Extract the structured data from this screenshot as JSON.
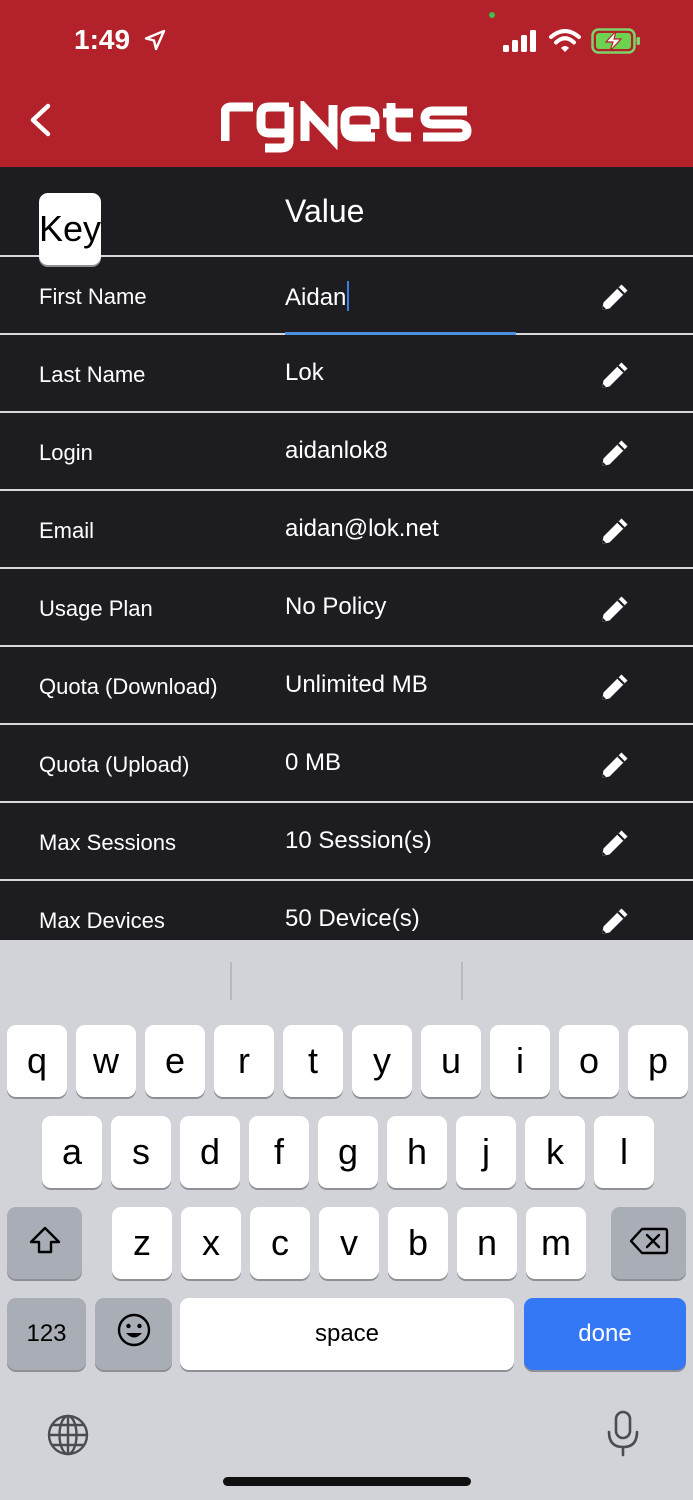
{
  "status_bar": {
    "time": "1:49"
  },
  "header": {
    "logo_text": "rgNets"
  },
  "table": {
    "key_header": "Key",
    "value_header": "Value",
    "rows": [
      {
        "key": "First Name",
        "value": "Aidan"
      },
      {
        "key": "Last Name",
        "value": "Lok"
      },
      {
        "key": "Login",
        "value": "aidanlok8"
      },
      {
        "key": "Email",
        "value": "aidan@lok.net"
      },
      {
        "key": "Usage Plan",
        "value": "No Policy"
      },
      {
        "key": "Quota (Download)",
        "value": "Unlimited MB"
      },
      {
        "key": "Quota (Upload)",
        "value": "0 MB"
      },
      {
        "key": "Max Sessions",
        "value": "10 Session(s)"
      },
      {
        "key": "Max Devices",
        "value": "50 Device(s)"
      }
    ]
  },
  "keyboard": {
    "row1": [
      "q",
      "w",
      "e",
      "r",
      "t",
      "y",
      "u",
      "i",
      "o",
      "p"
    ],
    "row2": [
      "a",
      "s",
      "d",
      "f",
      "g",
      "h",
      "j",
      "k",
      "l"
    ],
    "row3": [
      "z",
      "x",
      "c",
      "v",
      "b",
      "n",
      "m"
    ],
    "numbers_label": "123",
    "space_label": "space",
    "done_label": "done"
  },
  "colors": {
    "header_bg": "#b3212b",
    "table_bg": "#1c1c21",
    "accent": "#3478f6"
  }
}
